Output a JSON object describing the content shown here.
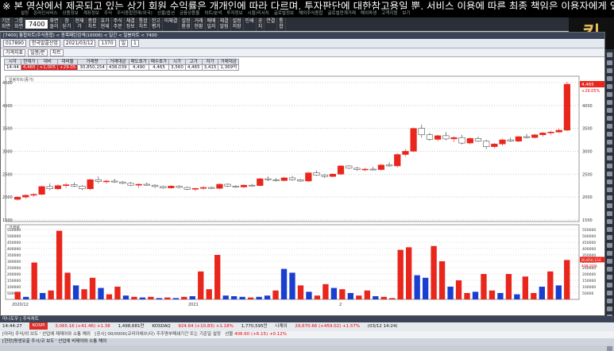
{
  "notice": "※ 본 영상에서 제공되고 있는 상기 회원 수익률은 개개인에 따라 다르며, 투자판단에 대한참고용일 뿐, 서비스 이용에 따른 최종 책임은 이용자에게 있습니다",
  "menu": [
    "설정",
    "온라인서비스",
    "상품정보",
    "계좌정보",
    "주식",
    "주식종합현재(외국)",
    "선물/옵션",
    "금융상품몰",
    "차트/분석",
    "투자정보",
    "시황/리서치",
    "글로벌정보",
    "해외주식종합",
    "글로벌연계거래",
    "해외파생",
    "고객지원",
    "보기"
  ],
  "toolbar": {
    "buttons": [
      "기본\n화면",
      "그룹\n화면",
      "7400",
      "화면\n돌이",
      "창\n닫기",
      "현재\n가",
      "종합\n차트",
      "호가\n현재",
      "주식\n주문",
      "체결\n정보",
      "통합\n차트",
      "잔고\n평가",
      "미체결",
      "설정\n환경",
      "거래\n현황",
      "매매\n일지",
      "체결\n알림",
      "설정\n저장",
      "인쇄",
      "공\n지",
      "연결",
      "통\n합"
    ],
    "code": "7400"
  },
  "logo": "킹",
  "window": {
    "title": "[7400] 통합차트(주식종합)  <  종목패턴검색(10006)  <  일간  <  일봉차트  <  7400"
  },
  "controls": {
    "stock_code": "017890",
    "stock_name": "한국알콜산업",
    "date": "2021/03/12",
    "period": "1370",
    "unit": "일",
    "count": "1"
  },
  "tabs": [
    "가격지표",
    "일봉/분",
    "차트"
  ],
  "quote": {
    "headers": [
      "시각",
      "현재가",
      "대비",
      "대비율",
      "거래량",
      "거래대금",
      "매도호가",
      "매수호가",
      "시가",
      "고가",
      "저가",
      "거래대금"
    ],
    "values": [
      "14:44",
      "4,465",
      "+1,005",
      "+29.05",
      "30,850,154",
      "438,039",
      "4,490",
      "4,465",
      "3,560",
      "4,465",
      "3,415",
      "1,369억"
    ]
  },
  "chart_labels": {
    "price_panel": "일봉차트(종가)",
    "volume_panel": "거래량",
    "last_price": "4,465",
    "last_pct": "+29.05%",
    "vol_last": "30,850,154",
    "vol_pct": "438.03%"
  },
  "chart_data": {
    "type": "candlestick",
    "price_axis": {
      "min": 1500,
      "max": 4500,
      "ticks": [
        "4500",
        "4000",
        "3500",
        "3000",
        "2500",
        "2000",
        "1500"
      ]
    },
    "volume_axis": {
      "ticks": [
        "550000",
        "500000",
        "450000",
        "400000",
        "350000",
        "300000",
        "250000",
        "200000",
        "150000",
        "100000",
        "50000"
      ]
    },
    "x_labels": [
      "2020/12",
      "2021",
      "2"
    ],
    "candles": [
      [
        1950,
        2020,
        1920,
        2000,
        "u"
      ],
      [
        2000,
        2060,
        1960,
        2040,
        "u"
      ],
      [
        2040,
        2080,
        2010,
        2060,
        "u"
      ],
      [
        2060,
        2250,
        2040,
        2230,
        "u"
      ],
      [
        2230,
        2300,
        2150,
        2180,
        "d"
      ],
      [
        2180,
        2280,
        2150,
        2250,
        "u"
      ],
      [
        2250,
        2310,
        2200,
        2270,
        "u"
      ],
      [
        2270,
        2320,
        2220,
        2240,
        "d"
      ],
      [
        2240,
        2260,
        2150,
        2180,
        "d"
      ],
      [
        2180,
        2400,
        2150,
        2380,
        "u"
      ],
      [
        2380,
        2450,
        2300,
        2340,
        "d"
      ],
      [
        2340,
        2380,
        2290,
        2350,
        "u"
      ],
      [
        2350,
        2400,
        2310,
        2330,
        "d"
      ],
      [
        2330,
        2350,
        2280,
        2300,
        "d"
      ],
      [
        2300,
        2330,
        2240,
        2260,
        "d"
      ],
      [
        2260,
        2300,
        2200,
        2280,
        "u"
      ],
      [
        2280,
        2320,
        2250,
        2260,
        "d"
      ],
      [
        2260,
        2280,
        2200,
        2230,
        "d"
      ],
      [
        2230,
        2250,
        2180,
        2200,
        "d"
      ],
      [
        2200,
        2260,
        2180,
        2240,
        "u"
      ],
      [
        2240,
        2260,
        2190,
        2210,
        "d"
      ],
      [
        2210,
        2230,
        2150,
        2170,
        "d"
      ],
      [
        2170,
        2200,
        2130,
        2190,
        "u"
      ],
      [
        2190,
        2240,
        2160,
        2210,
        "u"
      ],
      [
        2210,
        2230,
        2180,
        2190,
        "d"
      ],
      [
        2190,
        2300,
        2170,
        2280,
        "u"
      ],
      [
        2280,
        2300,
        2220,
        2240,
        "d"
      ],
      [
        2240,
        2260,
        2200,
        2220,
        "d"
      ],
      [
        2220,
        2280,
        2200,
        2260,
        "u"
      ],
      [
        2260,
        2290,
        2230,
        2250,
        "d"
      ],
      [
        2250,
        2420,
        2240,
        2400,
        "u"
      ],
      [
        2400,
        2450,
        2350,
        2380,
        "d"
      ],
      [
        2380,
        2420,
        2340,
        2360,
        "d"
      ],
      [
        2360,
        2440,
        2340,
        2420,
        "u"
      ],
      [
        2420,
        2460,
        2360,
        2380,
        "d"
      ],
      [
        2380,
        2400,
        2330,
        2350,
        "d"
      ],
      [
        2350,
        2550,
        2330,
        2530,
        "u"
      ],
      [
        2530,
        2580,
        2460,
        2480,
        "d"
      ],
      [
        2480,
        2500,
        2420,
        2450,
        "d"
      ],
      [
        2450,
        2520,
        2430,
        2500,
        "u"
      ],
      [
        2500,
        2700,
        2480,
        2680,
        "u"
      ],
      [
        2680,
        2700,
        2610,
        2630,
        "d"
      ],
      [
        2630,
        2660,
        2570,
        2600,
        "d"
      ],
      [
        2600,
        2640,
        2560,
        2610,
        "u"
      ],
      [
        2610,
        2660,
        2580,
        2600,
        "d"
      ],
      [
        2600,
        2720,
        2580,
        2700,
        "u"
      ],
      [
        2700,
        2760,
        2660,
        2680,
        "d"
      ],
      [
        2680,
        2960,
        2650,
        2930,
        "u"
      ],
      [
        2930,
        3050,
        2880,
        3000,
        "u"
      ],
      [
        3000,
        3520,
        2980,
        3500,
        "u"
      ],
      [
        3500,
        3580,
        3300,
        3360,
        "d"
      ],
      [
        3360,
        3400,
        3230,
        3260,
        "d"
      ],
      [
        3260,
        3360,
        3220,
        3340,
        "u"
      ],
      [
        3340,
        3420,
        3240,
        3270,
        "d"
      ],
      [
        3270,
        3330,
        3200,
        3300,
        "u"
      ],
      [
        3300,
        3360,
        3150,
        3180,
        "d"
      ],
      [
        3180,
        3300,
        3150,
        3280,
        "u"
      ],
      [
        3280,
        3320,
        3200,
        3220,
        "d"
      ],
      [
        3220,
        3250,
        3050,
        3100,
        "d"
      ],
      [
        3100,
        3180,
        3060,
        3160,
        "u"
      ],
      [
        3160,
        3280,
        3120,
        3250,
        "u"
      ],
      [
        3250,
        3300,
        3200,
        3220,
        "d"
      ],
      [
        3220,
        3330,
        3200,
        3320,
        "u"
      ],
      [
        3320,
        3380,
        3280,
        3300,
        "d"
      ],
      [
        3300,
        3380,
        3280,
        3360,
        "u"
      ],
      [
        3360,
        3420,
        3320,
        3400,
        "u"
      ],
      [
        3400,
        3450,
        3350,
        3420,
        "u"
      ],
      [
        3420,
        3500,
        3400,
        3460,
        "u"
      ],
      [
        3460,
        4520,
        3440,
        4465,
        "u"
      ]
    ],
    "volumes": [
      [
        60000,
        "u"
      ],
      [
        20000,
        "d"
      ],
      [
        290000,
        "u"
      ],
      [
        50000,
        "d"
      ],
      [
        70000,
        "u"
      ],
      [
        540000,
        "u"
      ],
      [
        210000,
        "u"
      ],
      [
        110000,
        "d"
      ],
      [
        80000,
        "u"
      ],
      [
        170000,
        "u"
      ],
      [
        90000,
        "d"
      ],
      [
        40000,
        "u"
      ],
      [
        100000,
        "u"
      ],
      [
        30000,
        "d"
      ],
      [
        20000,
        "u"
      ],
      [
        15000,
        "d"
      ],
      [
        20000,
        "u"
      ],
      [
        10000,
        "d"
      ],
      [
        15000,
        "u"
      ],
      [
        10000,
        "d"
      ],
      [
        20000,
        "u"
      ],
      [
        25000,
        "d"
      ],
      [
        220000,
        "u"
      ],
      [
        80000,
        "u"
      ],
      [
        350000,
        "u"
      ],
      [
        30000,
        "d"
      ],
      [
        25000,
        "d"
      ],
      [
        20000,
        "d"
      ],
      [
        15000,
        "u"
      ],
      [
        20000,
        "d"
      ],
      [
        30000,
        "d"
      ],
      [
        70000,
        "u"
      ],
      [
        240000,
        "d"
      ],
      [
        210000,
        "d"
      ],
      [
        110000,
        "u"
      ],
      [
        60000,
        "d"
      ],
      [
        30000,
        "u"
      ],
      [
        120000,
        "u"
      ],
      [
        90000,
        "d"
      ],
      [
        80000,
        "u"
      ],
      [
        50000,
        "d"
      ],
      [
        30000,
        "u"
      ],
      [
        70000,
        "u"
      ],
      [
        25000,
        "d"
      ],
      [
        20000,
        "u"
      ],
      [
        10000,
        "u"
      ],
      [
        390000,
        "u"
      ],
      [
        410000,
        "u"
      ],
      [
        190000,
        "d"
      ],
      [
        170000,
        "d"
      ],
      [
        420000,
        "u"
      ],
      [
        300000,
        "u"
      ],
      [
        100000,
        "d"
      ],
      [
        150000,
        "u"
      ],
      [
        50000,
        "u"
      ],
      [
        60000,
        "d"
      ],
      [
        200000,
        "u"
      ],
      [
        70000,
        "u"
      ],
      [
        50000,
        "d"
      ],
      [
        200000,
        "u"
      ],
      [
        40000,
        "d"
      ],
      [
        180000,
        "u"
      ],
      [
        50000,
        "u"
      ],
      [
        100000,
        "d"
      ],
      [
        220000,
        "u"
      ],
      [
        110000,
        "d"
      ],
      [
        310000,
        "u"
      ]
    ]
  },
  "bottom": {
    "title": "미니도우 | 주식차트",
    "clock": "14:44:27",
    "kospi": "KOSPI",
    "kospi_val": "3,065.16 (+41.46) +1.38",
    "kospi_vol": "1,498,681만",
    "kosdaq": "KOSDAQ",
    "kosdaq_val": "924.64 (+10.83) +1.18%",
    "kosdaq_vol": "1,770,595만",
    "nikkei": "니케이",
    "nikkei_val": "29,670.66 (+459.02) +1.57%",
    "ticker_date": "(03/12 14:24)",
    "news": "[아라] 주식/외 브도 ' 산업에 제제아와 소통 해외",
    "news2": "[공시] 00/0000(코리아에쓰)다) 주주명부폐쇄기간 또는 기준일 설정",
    "futures_label": "선물",
    "futures_val": "406.60 (+6.15) +0.12%",
    "taskbar": [
      "[현장]평생유출",
      "주시/코 보도 ' 산업에 비제야와 소통 해외"
    ]
  }
}
